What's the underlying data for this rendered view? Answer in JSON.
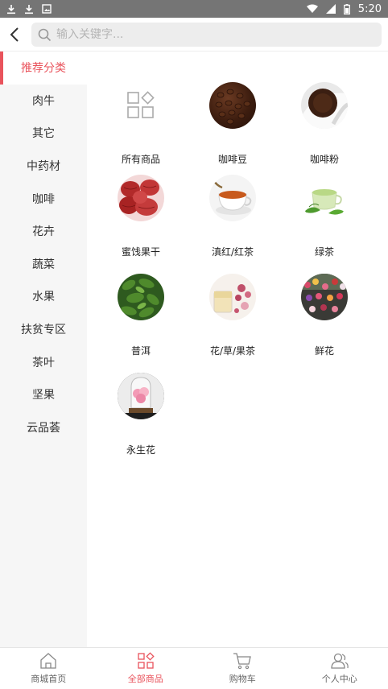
{
  "status": {
    "time": "5:20"
  },
  "search": {
    "placeholder": "输入关键字..."
  },
  "sidebar": {
    "items": [
      {
        "label": "推荐分类",
        "active": true
      },
      {
        "label": "肉牛"
      },
      {
        "label": "其它"
      },
      {
        "label": "中药材"
      },
      {
        "label": "咖啡"
      },
      {
        "label": "花卉"
      },
      {
        "label": "蔬菜"
      },
      {
        "label": "水果"
      },
      {
        "label": "扶贫专区"
      },
      {
        "label": "茶叶"
      },
      {
        "label": "坚果"
      },
      {
        "label": "云品荟"
      }
    ]
  },
  "categories": [
    {
      "label": "所有商品",
      "icon": "grid-icon"
    },
    {
      "label": "咖啡豆",
      "icon": "coffee-beans-image"
    },
    {
      "label": "咖啡粉",
      "icon": "coffee-powder-image"
    },
    {
      "label": "蜜饯果干",
      "icon": "dried-fruit-image"
    },
    {
      "label": "滇红/红茶",
      "icon": "black-tea-image"
    },
    {
      "label": "绿茶",
      "icon": "green-tea-image"
    },
    {
      "label": "普洱",
      "icon": "puer-image"
    },
    {
      "label": "花/草/果茶",
      "icon": "flower-tea-image"
    },
    {
      "label": "鲜花",
      "icon": "fresh-flowers-image"
    },
    {
      "label": "永生花",
      "icon": "preserved-flower-image"
    }
  ],
  "tabbar": {
    "tabs": [
      {
        "label": "商城首页",
        "icon": "home-icon"
      },
      {
        "label": "全部商品",
        "icon": "categories-icon",
        "active": true
      },
      {
        "label": "购物车",
        "icon": "cart-icon"
      },
      {
        "label": "个人中心",
        "icon": "user-icon"
      }
    ]
  },
  "colors": {
    "accent": "#e9535c",
    "statusbar": "#757575",
    "sidebar_bg": "#f6f6f6"
  }
}
